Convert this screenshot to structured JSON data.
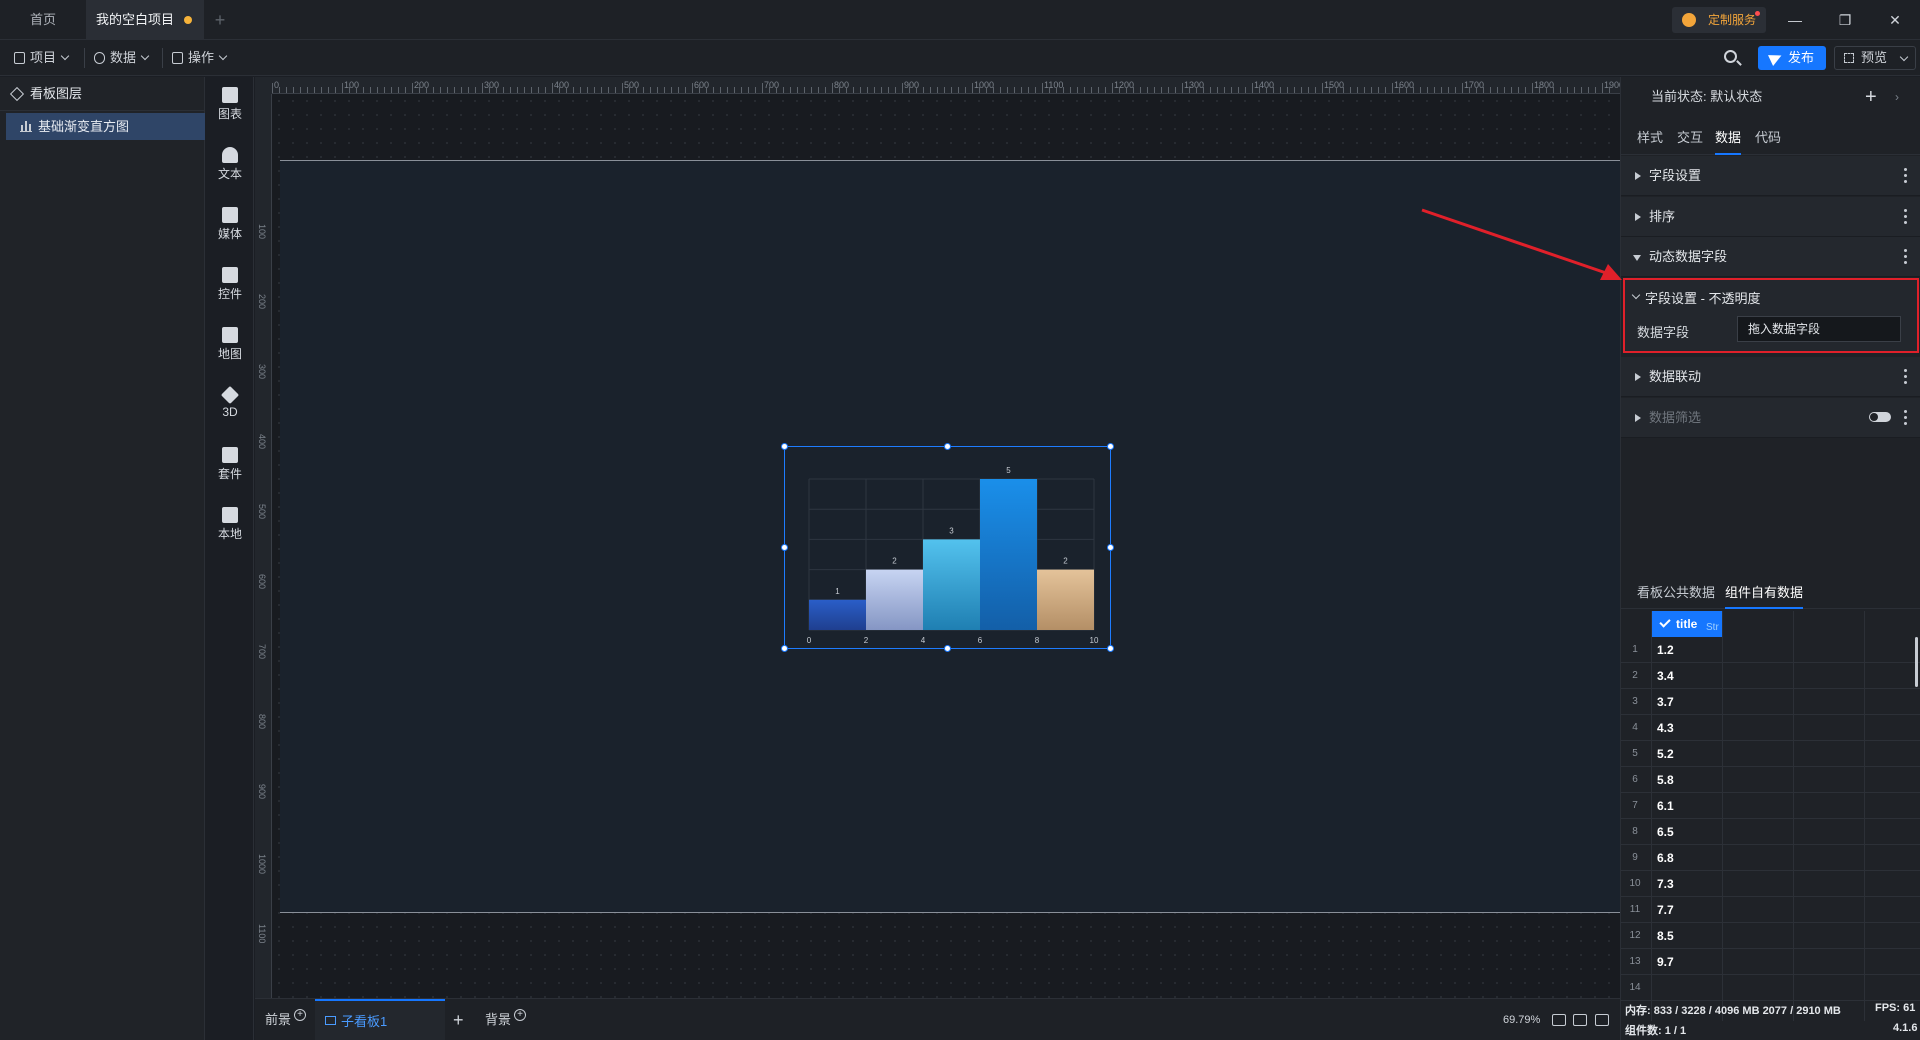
{
  "tabs": {
    "home": "首页",
    "project": "我的空白项目"
  },
  "window": {
    "custom_service": "定制服务"
  },
  "toolbar": {
    "project": "项目",
    "data": "数据",
    "ops": "操作",
    "publish": "发布",
    "preview": "预览"
  },
  "layers": {
    "title": "看板图层",
    "item": "基础渐变直方图"
  },
  "components": [
    "图表",
    "文本",
    "媒体",
    "控件",
    "地图",
    "3D",
    "套件",
    "本地"
  ],
  "ruler": {
    "h_ticks": [
      "0",
      "100",
      "200",
      "300",
      "400",
      "500",
      "600",
      "700",
      "800",
      "900",
      "1000",
      "1100",
      "1200",
      "1300",
      "1400",
      "1500",
      "1600",
      "1700",
      "1800",
      "1900"
    ],
    "v_ticks": [
      "100",
      "200",
      "300",
      "400",
      "500",
      "600",
      "700",
      "800",
      "900",
      "1000",
      "1100"
    ]
  },
  "chart_data": {
    "type": "bar",
    "x": [
      0,
      2,
      4,
      6,
      8,
      10
    ],
    "bins": [
      [
        0,
        2
      ],
      [
        2,
        4
      ],
      [
        4,
        6
      ],
      [
        6,
        8
      ],
      [
        8,
        10
      ]
    ],
    "values": [
      1,
      2,
      3,
      5,
      2
    ],
    "xlim": [
      0,
      10
    ],
    "ylim": [
      0,
      5
    ],
    "grid": true,
    "colors": [
      [
        "#2a5ec8",
        "#1f3f8f"
      ],
      [
        "#c7d4f2",
        "#8596c4"
      ],
      [
        "#53c2ee",
        "#1f7fb2"
      ],
      [
        "#1a8fea",
        "#135fa8"
      ],
      [
        "#e4c39a",
        "#b48f66"
      ]
    ],
    "data_labels": true
  },
  "bottombar": {
    "front": "前景",
    "sub": "子看板1",
    "back": "背景",
    "zoom": "69.79%"
  },
  "rpanel": {
    "state_label": "当前状态:",
    "state_value": "默认状态",
    "tabs": [
      "样式",
      "交互",
      "数据",
      "代码"
    ],
    "active_tab": "数据",
    "sections": {
      "field_settings": "字段设置",
      "sort": "排序",
      "dynamic_fields": "动态数据字段",
      "linkage": "数据联动",
      "filter": "数据筛选"
    },
    "highlight": {
      "title": "字段设置 - 不透明度",
      "label": "数据字段",
      "placeholder": "拖入数据字段"
    },
    "data_tabs": [
      "看板公共数据",
      "组件自有数据"
    ],
    "grid": {
      "column": "title",
      "column_type": "Str",
      "rows": [
        "1.2",
        "3.4",
        "3.7",
        "4.3",
        "5.2",
        "5.8",
        "6.1",
        "6.5",
        "6.8",
        "7.3",
        "7.7",
        "8.5",
        "9.7",
        ""
      ],
      "row_numbers": [
        "1",
        "2",
        "3",
        "4",
        "5",
        "6",
        "7",
        "8",
        "9",
        "10",
        "11",
        "12",
        "13",
        "14"
      ]
    },
    "status": {
      "mem": "内存: 833 / 3228 / 4096 MB  2077 / 2910 MB",
      "fps": "FPS: 61",
      "count": "组件数: 1 / 1",
      "version": "4.1.6"
    }
  }
}
